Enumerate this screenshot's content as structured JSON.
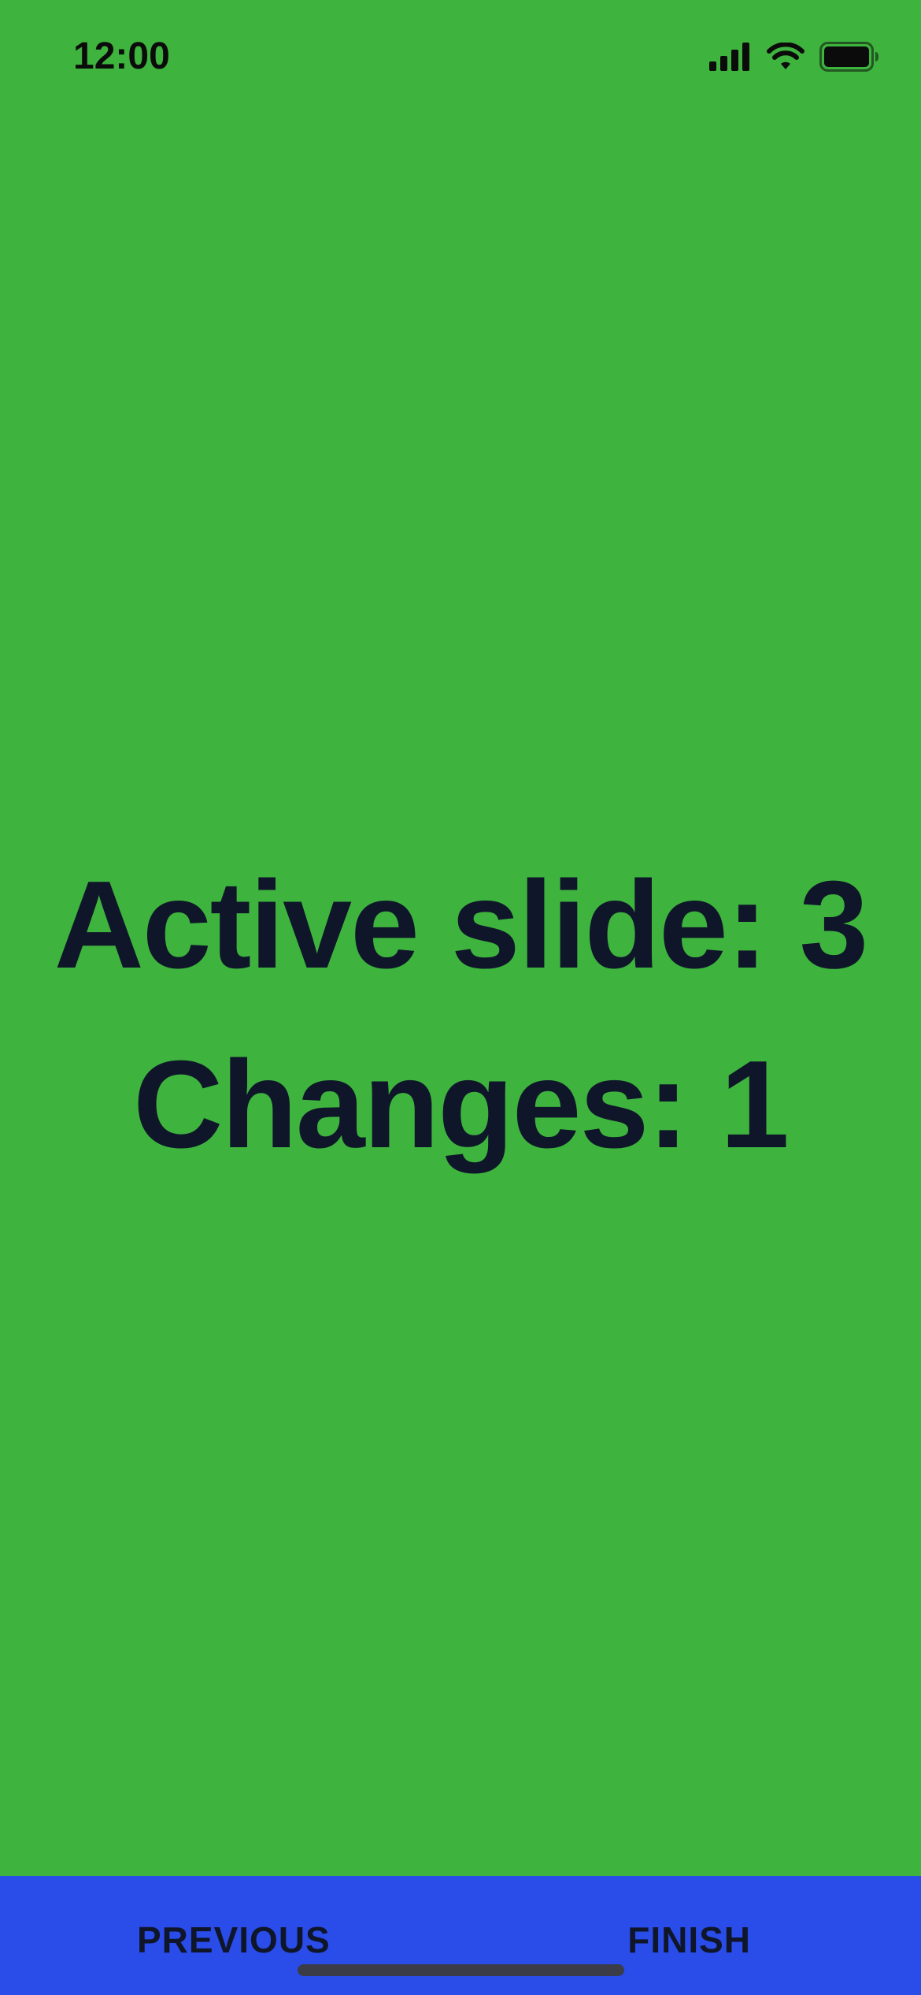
{
  "status_bar": {
    "time": "12:00",
    "icons": [
      "cellular-signal-icon",
      "wifi-icon",
      "battery-icon"
    ]
  },
  "slide": {
    "active_line": "Active slide: 3",
    "changes_line": "Changes: 1"
  },
  "footer": {
    "previous_label": "PREVIOUS",
    "finish_label": "FINISH"
  },
  "colors": {
    "background": "#3eb33e",
    "footer_background": "#2a4ce8",
    "text": "#0f1629"
  }
}
